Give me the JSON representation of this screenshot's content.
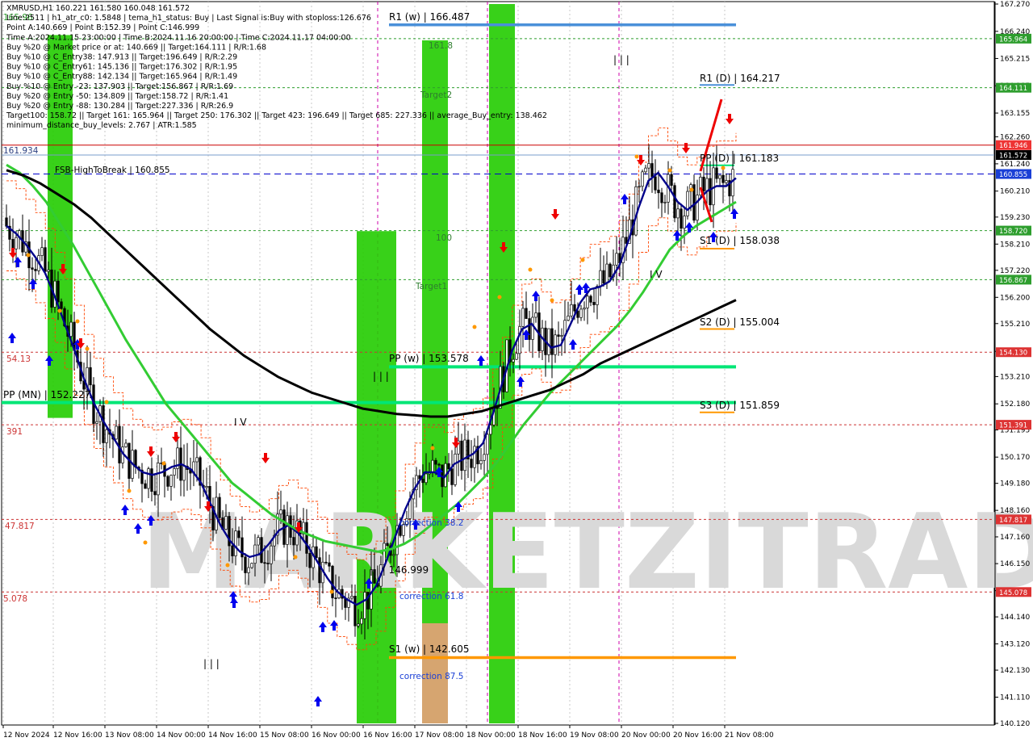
{
  "info_panel": [
    "XMRUSD,H1  160.221 161.580 160.048 161.572",
    "Line:2511 | h1_atr_c0: 1.5848 | tema_h1_status: Buy | Last Signal is:Buy with stoploss:126.676",
    "Point A:140.669 | Point B:152.39 | Point C:146.999",
    "Time A:2024.11.15 23:00:00 | Time B:2024.11.16 20:00:00 | Time C:2024.11.17 04:00:00",
    "Buy %20 @ Market price or at: 140.669 || Target:164.111 | R/R:1.68",
    "Buy %10 @ C_Entry38: 147.913 || Target:196.649 | R/R:2.29",
    "Buy %10 @ C_Entry61: 145.136 || Target:176.302 | R/R:1.95",
    "Buy %10 @ C_Entry88: 142.134 || Target:165.964 | R/R:1.49",
    "Buy %10 @ Entry -23: 137.903 || Target:156.867 | R/R:1.69",
    "Buy %20 @ Entry -50: 134.809 || Target:158.72 | R/R:1.41",
    "Buy %20 @ Entry -88: 130.284 || Target:227.336 | R/R:26.9",
    "Target100: 158.72 || Target 161: 165.964 || Target 250: 176.302 || Target 423: 196.649 || Target 685: 227.336 || average_Buy_entry: 138.462",
    "minimum_distance_buy_levels: 2.767 | ATR:1.585"
  ],
  "watermark": "MARKETZITRADE",
  "colors": {
    "background": "#ffffff",
    "grid": "#c8c8c8",
    "candle": "#000000",
    "tema": "#00008b",
    "sma_green": "#33cc33",
    "sma_black": "#000000",
    "channel": "#ff4400",
    "weekly_pivot": "#00e676",
    "resistance": "#4a90d9",
    "support": "#ff9800",
    "target_green": "#22cc00",
    "target_salmon": "#e8a07a",
    "buy_arrow": "#0000ee",
    "sell_arrow": "#ee0000",
    "bid_line": "#cc0000",
    "dash_blue": "#0000cc"
  },
  "chart_data": {
    "type": "line",
    "symbol": "XMRUSD",
    "timeframe": "H1",
    "ohlc_last": {
      "open": 160.221,
      "high": 161.58,
      "low": 160.048,
      "close": 161.572
    },
    "ylim": [
      140.12,
      167.27
    ],
    "y_ticks": [
      "167.270",
      "166.240",
      "165.215",
      "164.185",
      "163.155",
      "162.260",
      "161.240",
      "160.210",
      "159.230",
      "158.210",
      "157.220",
      "156.200",
      "155.210",
      "154.160",
      "153.210",
      "152.180",
      "151.195",
      "150.170",
      "149.180",
      "148.160",
      "147.160",
      "146.150",
      "145.130",
      "144.140",
      "143.120",
      "142.130",
      "141.110",
      "140.120"
    ],
    "x_ticks": [
      "12 Nov 2024",
      "12 Nov 16:00",
      "13 Nov 08:00",
      "14 Nov 00:00",
      "14 Nov 16:00",
      "15 Nov 08:00",
      "16 Nov 00:00",
      "16 Nov 16:00",
      "17 Nov 08:00",
      "18 Nov 00:00",
      "18 Nov 16:00",
      "19 Nov 08:00",
      "20 Nov 00:00",
      "20 Nov 16:00",
      "21 Nov 08:00"
    ],
    "price_tags": [
      {
        "value": "165.964",
        "color": "#2e9e2e"
      },
      {
        "value": "164.111",
        "color": "#2e9e2e"
      },
      {
        "value": "161.946",
        "color": "#ee3333"
      },
      {
        "value": "161.572",
        "color": "#000000"
      },
      {
        "value": "160.855",
        "color": "#1a3fd6"
      },
      {
        "value": "158.720",
        "color": "#2e9e2e"
      },
      {
        "value": "156.867",
        "color": "#2e9e2e"
      },
      {
        "value": "154.130",
        "color": "#dd3333"
      },
      {
        "value": "151.391",
        "color": "#dd3333"
      },
      {
        "value": "147.817",
        "color": "#dd3333"
      },
      {
        "value": "145.078",
        "color": "#dd3333"
      }
    ],
    "levels": {
      "r1_w": {
        "label": "R1 (w) | 166.487",
        "value": 166.487
      },
      "r1_d": {
        "label": "R1 (D) | 164.217",
        "value": 164.217
      },
      "pp_d": {
        "label": "PP (D) | 161.183",
        "value": 161.183
      },
      "s1_d": {
        "label": "S1 (D) | 158.038",
        "value": 158.038
      },
      "s2_d": {
        "label": "S2 (D) | 155.004",
        "value": 155.004
      },
      "s3_d": {
        "label": "S3 (D) | 151.859",
        "value": 151.859
      },
      "pp_w": {
        "label": "PP (w) | 153.578",
        "value": 153.578
      },
      "pp_mn": {
        "label": "PP (MN) | 152.227",
        "value": 152.227
      },
      "s1_w": {
        "label": "S1 (w) | 142.605",
        "value": 142.605
      },
      "fsb": {
        "label": "FSB-HighToBreak | 160.855",
        "value": 160.855
      },
      "point_c": {
        "label": "| | | 146.999",
        "value": 146.999
      }
    },
    "left_edge_labels": [
      "161.934",
      "54.13",
      "391",
      "47.817",
      "5.078",
      "165.96"
    ],
    "annotations": [
      "161.8",
      "Target2",
      "100",
      "Target1",
      "correction 38.2",
      "correction 61.8",
      "correction 87.5",
      "| | |",
      "I V",
      "| | |",
      "I V",
      "| | |"
    ],
    "series": [
      {
        "name": "TEMA",
        "values": [
          158.9,
          158.6,
          158.2,
          157.7,
          157.1,
          156.2,
          155.2,
          154.2,
          153.1,
          152.2,
          151.5,
          150.9,
          150.3,
          149.9,
          149.6,
          149.5,
          149.6,
          149.8,
          149.9,
          149.7,
          149.2,
          148.4,
          147.6,
          147.0,
          146.6,
          146.4,
          146.5,
          146.9,
          147.4,
          147.6,
          147.3,
          146.8,
          146.2,
          145.6,
          145.1,
          144.8,
          144.6,
          144.8,
          145.3,
          146.2,
          147.2,
          148.2,
          149.0,
          149.6,
          149.6,
          149.4,
          149.9,
          150.1,
          150.3,
          150.7,
          151.8,
          153.0,
          154.2,
          155.0,
          155.2,
          154.7,
          154.3,
          154.4,
          155.2,
          156.0,
          156.5,
          156.6,
          156.8,
          157.4,
          158.4,
          159.6,
          160.6,
          160.9,
          160.4,
          159.8,
          159.5,
          159.8,
          160.2,
          160.4,
          160.4,
          160.7
        ]
      },
      {
        "name": "SMA",
        "values": [
          161.2,
          160.9,
          160.4,
          159.8,
          159.0,
          158.2,
          157.3,
          156.4,
          155.5,
          154.6,
          153.8,
          153.0,
          152.2,
          151.6,
          151.0,
          150.4,
          149.8,
          149.2,
          148.8,
          148.4,
          148.0,
          147.7,
          147.4,
          147.2,
          147.0,
          146.9,
          146.8,
          146.7,
          146.6,
          146.7,
          146.9,
          147.2,
          147.6,
          148.0,
          148.4,
          148.9,
          149.4,
          150.0,
          150.7,
          151.4,
          152.0,
          152.6,
          153.1,
          153.6,
          154.1,
          154.6,
          155.1,
          155.7,
          156.4,
          157.2,
          158.0,
          158.5,
          158.9,
          159.2,
          159.5,
          159.8
        ]
      },
      {
        "name": "SMA",
        "values": [
          161.0,
          160.8,
          160.5,
          160.1,
          159.7,
          159.2,
          158.6,
          158.0,
          157.4,
          156.8,
          156.2,
          155.6,
          155.0,
          154.5,
          154.0,
          153.6,
          153.2,
          152.9,
          152.6,
          152.4,
          152.2,
          152.0,
          151.9,
          151.8,
          151.75,
          151.7,
          151.7,
          151.8,
          151.9,
          152.1,
          152.3,
          152.5,
          152.7,
          153.0,
          153.3,
          153.7,
          154.0,
          154.3,
          154.6,
          154.9,
          155.2,
          155.5,
          155.8,
          156.1
        ]
      }
    ]
  }
}
